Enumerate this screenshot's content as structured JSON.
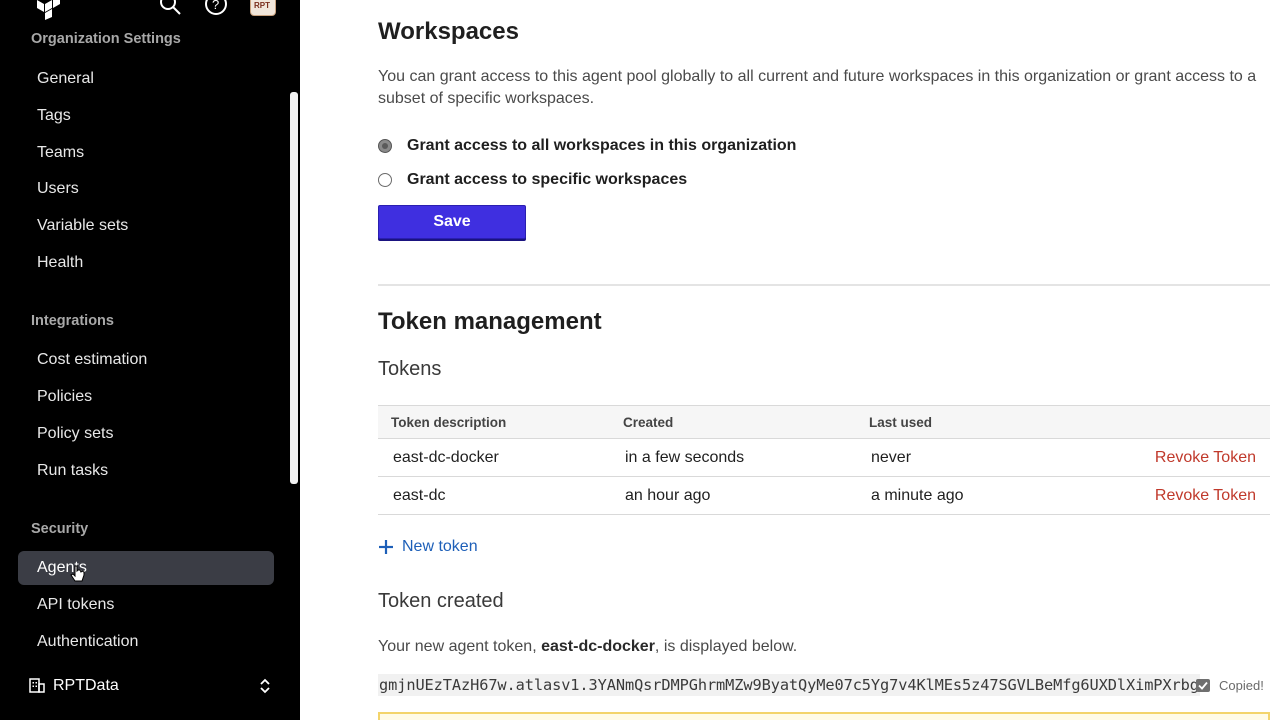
{
  "sidebar": {
    "org_settings_label": "Organization Settings",
    "org_items": [
      "General",
      "Tags",
      "Teams",
      "Users",
      "Variable sets",
      "Health"
    ],
    "integrations_label": "Integrations",
    "integration_items": [
      "Cost estimation",
      "Policies",
      "Policy sets",
      "Run tasks"
    ],
    "security_label": "Security",
    "security_items": [
      "Agents",
      "API tokens",
      "Authentication"
    ],
    "active_item": "Agents",
    "org_name": "RPTData",
    "avatar_text": "RPT"
  },
  "workspaces": {
    "title": "Workspaces",
    "description": "You can grant access to this agent pool globally to all current and future workspaces in this organization or grant access to a subset of specific workspaces.",
    "radio_all": "Grant access to all workspaces in this organization",
    "radio_specific": "Grant access to specific workspaces",
    "save_label": "Save"
  },
  "token_management": {
    "title": "Token management",
    "tokens_title": "Tokens",
    "columns": [
      "Token description",
      "Created",
      "Last used"
    ],
    "rows": [
      {
        "description": "east-dc-docker",
        "created": "in a few seconds",
        "last_used": "never",
        "action": "Revoke Token"
      },
      {
        "description": "east-dc",
        "created": "an hour ago",
        "last_used": "a minute ago",
        "action": "Revoke Token"
      }
    ],
    "new_token_label": "New token",
    "created_title": "Token created",
    "created_prefix": "Your new agent token, ",
    "created_token_name": "east-dc-docker",
    "created_suffix": ", is displayed below.",
    "token_value": "gmjnUEzTAzH67w.atlasv1.3YANmQsrDMPGhrmMZw9ByatQyMe07c5Yg7v4KlMEs5z47SGVLBeMfg6UXDlXimPXrbg",
    "copied_label": "Copied!"
  },
  "colors": {
    "sidebar_bg": "#000000",
    "active_nav": "#3b3d45",
    "primary_button": "#3f2fe0",
    "revoke_red": "#c0392b",
    "link_blue": "#1d5fb8"
  }
}
